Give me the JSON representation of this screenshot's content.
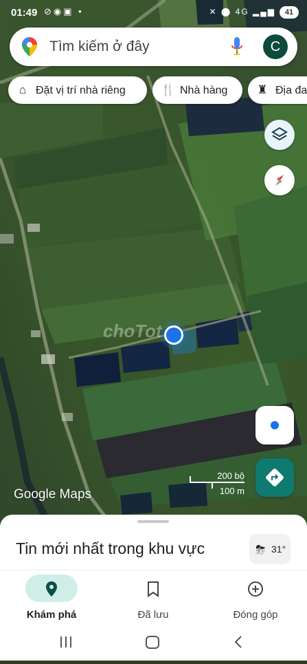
{
  "status_bar": {
    "time": "01:49",
    "network": "4G",
    "battery": "41"
  },
  "search": {
    "placeholder": "Tìm kiếm ở đây",
    "avatar_letter": "C"
  },
  "chips": [
    {
      "label": "Đặt vị trí nhà riêng",
      "icon": "home-icon"
    },
    {
      "label": "Nhà hàng",
      "icon": "restaurant-icon"
    },
    {
      "label": "Địa đa",
      "icon": "landmark-icon"
    }
  ],
  "map": {
    "watermark": "choTot",
    "scale_ft": "200 bộ",
    "scale_m": "100 m",
    "attribution": "Google Maps"
  },
  "sheet": {
    "title": "Tin mới nhất trong khu vực",
    "temperature": "31°"
  },
  "bottom_nav": [
    {
      "label": "Khám phá",
      "icon": "explore-pin-icon",
      "active": true
    },
    {
      "label": "Đã lưu",
      "icon": "bookmark-icon",
      "active": false
    },
    {
      "label": "Đóng góp",
      "icon": "add-circle-icon",
      "active": false
    }
  ],
  "colors": {
    "accent_teal": "#0e7a70",
    "location_blue": "#1a73e8",
    "active_pill": "#cfeee8"
  }
}
